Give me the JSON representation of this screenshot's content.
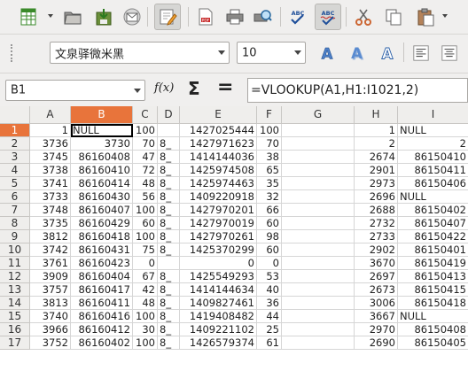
{
  "toolbar": {
    "icons": [
      "spreadsheet-icon",
      "folder-open-icon",
      "save-icon",
      "email-icon",
      "edit-mode-icon",
      "export-pdf-icon",
      "print-icon",
      "print-preview-icon",
      "spellcheck-icon",
      "autospellcheck-icon",
      "cut-icon",
      "copy-icon",
      "paste-icon"
    ]
  },
  "format": {
    "font_name": "文泉驿微米黑",
    "font_size": "10"
  },
  "formula": {
    "name_box": "B1",
    "function_wizard_label": "f(x)",
    "sum_label": "Σ",
    "equals_label": "=",
    "content": "=VLOOKUP(A1,H1:I1021,2)"
  },
  "columns": [
    "A",
    "B",
    "C",
    "D",
    "E",
    "F",
    "G",
    "H",
    "I"
  ],
  "selected_column": "B",
  "selected_row": "1",
  "rows": [
    {
      "n": "1",
      "A": "1",
      "B": "NULL",
      "C": "100",
      "D": "",
      "E": "1427025444",
      "F": "100",
      "G": "",
      "H": "1",
      "I": "NULL"
    },
    {
      "n": "2",
      "A": "3736",
      "B": "3730",
      "C": "70",
      "D": "8_",
      "E": "1427971623",
      "F": "70",
      "G": "",
      "H": "2",
      "I": "2"
    },
    {
      "n": "3",
      "A": "3745",
      "B": "86160408",
      "C": "47",
      "D": "8_",
      "E": "1414144036",
      "F": "38",
      "G": "",
      "H": "2674",
      "I": "86150410"
    },
    {
      "n": "4",
      "A": "3738",
      "B": "86160410",
      "C": "72",
      "D": "8_",
      "E": "1425974508",
      "F": "65",
      "G": "",
      "H": "2901",
      "I": "86150411"
    },
    {
      "n": "5",
      "A": "3741",
      "B": "86160414",
      "C": "48",
      "D": "8_",
      "E": "1425974463",
      "F": "35",
      "G": "",
      "H": "2973",
      "I": "86150406"
    },
    {
      "n": "6",
      "A": "3733",
      "B": "86160430",
      "C": "56",
      "D": "8_",
      "E": "1409220918",
      "F": "32",
      "G": "",
      "H": "2696",
      "I": "NULL"
    },
    {
      "n": "7",
      "A": "3748",
      "B": "86160407",
      "C": "100",
      "D": "8_",
      "E": "1427970201",
      "F": "66",
      "G": "",
      "H": "2688",
      "I": "86150402"
    },
    {
      "n": "8",
      "A": "3735",
      "B": "86160429",
      "C": "60",
      "D": "8_",
      "E": "1427970019",
      "F": "60",
      "G": "",
      "H": "2732",
      "I": "86150407"
    },
    {
      "n": "9",
      "A": "3812",
      "B": "86160418",
      "C": "100",
      "D": "8_",
      "E": "1427970261",
      "F": "98",
      "G": "",
      "H": "2733",
      "I": "86150422"
    },
    {
      "n": "10",
      "A": "3742",
      "B": "86160431",
      "C": "75",
      "D": "8_",
      "E": "1425370299",
      "F": "60",
      "G": "",
      "H": "2902",
      "I": "86150401"
    },
    {
      "n": "11",
      "A": "3761",
      "B": "86160423",
      "C": "0",
      "D": "",
      "E": "0",
      "F": "0",
      "G": "",
      "H": "3670",
      "I": "86150419"
    },
    {
      "n": "12",
      "A": "3909",
      "B": "86160404",
      "C": "67",
      "D": "8_",
      "E": "1425549293",
      "F": "53",
      "G": "",
      "H": "2697",
      "I": "86150413"
    },
    {
      "n": "13",
      "A": "3757",
      "B": "86160417",
      "C": "42",
      "D": "8_",
      "E": "1414144634",
      "F": "40",
      "G": "",
      "H": "2673",
      "I": "86150415"
    },
    {
      "n": "14",
      "A": "3813",
      "B": "86160411",
      "C": "48",
      "D": "8_",
      "E": "1409827461",
      "F": "36",
      "G": "",
      "H": "3006",
      "I": "86150418"
    },
    {
      "n": "15",
      "A": "3740",
      "B": "86160416",
      "C": "100",
      "D": "8_",
      "E": "1419408482",
      "F": "44",
      "G": "",
      "H": "3667",
      "I": "NULL"
    },
    {
      "n": "16",
      "A": "3966",
      "B": "86160412",
      "C": "30",
      "D": "8_",
      "E": "1409221102",
      "F": "25",
      "G": "",
      "H": "2970",
      "I": "86150408"
    },
    {
      "n": "17",
      "A": "3752",
      "B": "86160402",
      "C": "100",
      "D": "8_",
      "E": "1426579374",
      "F": "61",
      "G": "",
      "H": "2690",
      "I": "86150405"
    }
  ]
}
